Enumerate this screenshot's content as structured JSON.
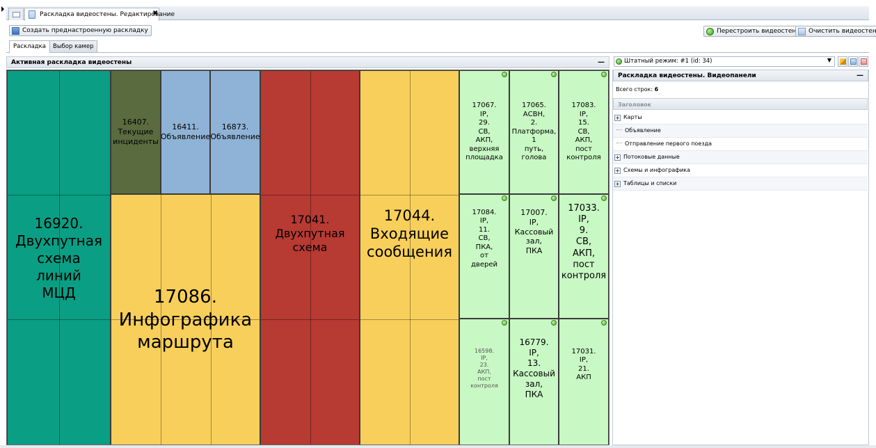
{
  "tab_strip": {
    "doc_tab_title": "Раскладка видеостены. Редактирование",
    "close_glyph": "✖"
  },
  "toolbar": {
    "create_preset_label": "Создать преднастроенную раскладку",
    "rebuild_label": "Перестроить видеостену",
    "clear_label": "Очистить видеостену"
  },
  "section_tabs": [
    {
      "label": "Раскладка",
      "active": true
    },
    {
      "label": "Выбор камер",
      "active": false
    }
  ],
  "layout_panel": {
    "title": "Активная раскладка видеостены",
    "collapse_glyph": "—"
  },
  "colors": {
    "teal": "#0a9e84",
    "olive": "#5a6b40",
    "steel_blue": "#8fb3d6",
    "yellow": "#f8cf5a",
    "red": "#b73a33",
    "light_green": "#c8f8c4"
  },
  "wall_panels": {
    "p16920": "16920.\nДвухпутная\nсхема\nлиний\nМЦД",
    "p16407": "16407.\nТекущие\nинциденты",
    "p16411": "16411.\nОбъявление",
    "p16873": "16873.\nОбъявление",
    "p17086": "17086.\nИнфографика\nмаршрута",
    "p17041": "17041.\nДвухпутная\nсхема",
    "p17044": "17044.\nВходящие\nсообщения",
    "p17067": "17067.\nIP,\n29.\nСВ,\nАКП,\nверхняя\nплощадка",
    "p17065": "17065.\nАСВН,\n2.\nПлатформа,\n1\nпуть,\nголова",
    "p17083": "17083.\nIP,\n15.\nСВ,\nАКП,\nпост\nконтроля",
    "p17084": "17084.\nIP,\n11.\nСВ,\nПКА,\nот\nдверей",
    "p17007": "17007.\nIP,\nКассовый\nзал,\nПКА",
    "p17033": "17033.\nIP,\n9.\nСВ,\nАКП,\nпост\nконтроля",
    "p16598": "16598.\nIP,\n23.\nАКП,\nпост\nконтроля",
    "p16779": "16779.\nIP,\n13.\nКассовый\nзал,\nПКА",
    "p17031": "17031.\nIP,\n21.\nАКП"
  },
  "right_panel": {
    "mode_value": "Штатный режим: #1 (id: 34)",
    "title": "Раскладка видеостены. Видеопанели",
    "collapse_glyph": "—",
    "row_count_label": "Всего строк:",
    "row_count_value": "6",
    "column_header": "Заголовок",
    "tree": [
      {
        "label": "Карты",
        "type": "group"
      },
      {
        "label": "Объявление",
        "type": "leaf"
      },
      {
        "label": "Отправление первого поезда",
        "type": "leaf"
      },
      {
        "label": "Потоковые данные",
        "type": "group"
      },
      {
        "label": "Схемы и инфографика",
        "type": "group"
      },
      {
        "label": "Таблицы и списки",
        "type": "group"
      }
    ]
  }
}
